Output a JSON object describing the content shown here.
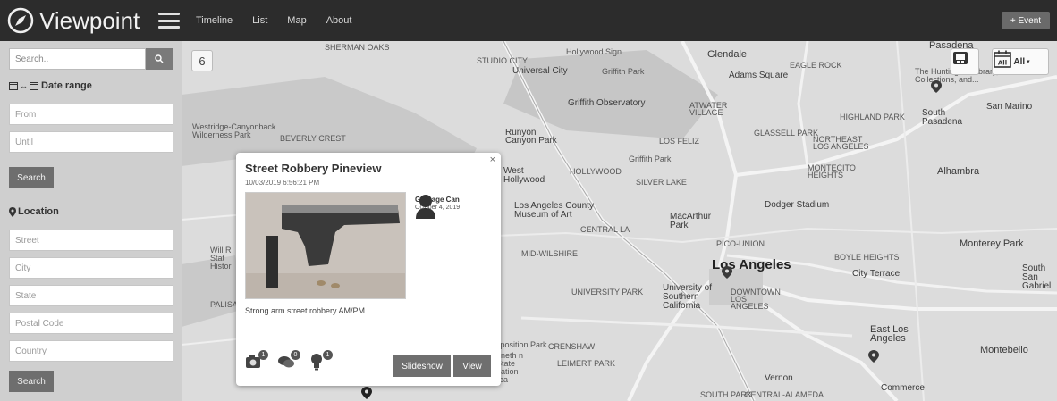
{
  "app": {
    "brand": "Viewpoint",
    "event_button": "+ Event"
  },
  "nav": [
    "Timeline",
    "List",
    "Map",
    "About"
  ],
  "sidebar": {
    "search_placeholder": "Search..",
    "date_range_label": "Date range",
    "from_placeholder": "From",
    "until_placeholder": "Until",
    "search_button": "Search",
    "location_label": "Location",
    "street_placeholder": "Street",
    "city_placeholder": "City",
    "state_placeholder": "State",
    "postal_placeholder": "Postal Code",
    "country_placeholder": "Country",
    "location_search_button": "Search"
  },
  "map": {
    "count": "6",
    "filter_label": "All",
    "calendar_icon_text": "All",
    "labels": {
      "universal_city": "Universal City",
      "studio_city": "STUDIO CITY",
      "glendale": "Glendale",
      "pasadena": "Pasadena",
      "adams_square": "Adams Square",
      "griffith_park": "Griffith Park",
      "griffith_obs": "Griffith Observatory",
      "huntington": "The Huntington Library, Art Collections, and...",
      "san_marino": "San Marino",
      "south_pasadena": "South Pasadena",
      "westridge": "Westridge-Canyonback Wilderness Park",
      "runyon": "Runyon Canyon Park",
      "los_feliz": "LOS FELIZ",
      "west_hollywood": "West Hollywood",
      "hollywood": "HOLLYWOOD",
      "silver_lake": "SILVER LAKE",
      "alhambra": "Alhambra",
      "lacma": "Los Angeles County Museum of Art",
      "macarthur": "MacArthur Park",
      "dodger": "Dodger Stadium",
      "monterey_park": "Monterey Park",
      "los_angeles": "Los Angeles",
      "city_terrace": "City Terrace",
      "south_san_gabriel": "South San Gabriel",
      "usc": "University of Southern California",
      "downtown": "DOWNTOWN LOS ANGELES",
      "east_la": "East Los Angeles",
      "montebello": "Montebello",
      "vernon": "Vernon",
      "commerce": "Commerce",
      "hollywood_sign": "Hollywood Sign",
      "highland_park": "HIGHLAND PARK",
      "glassell_park": "GLASSELL PARK",
      "eagle_rock": "EAGLE ROCK",
      "atwater": "ATWATER VILLAGE",
      "northeast": "NORTHEAST LOS ANGELES",
      "montecito": "MONTECITO HEIGHTS",
      "central_la": "CENTRAL LA",
      "mid_wilshire": "MID-WILSHIRE",
      "pico_union": "PICO-UNION",
      "university_park": "UNIVERSITY PARK",
      "boyle": "BOYLE HEIGHTS",
      "crenshaw": "CRENSHAW",
      "leimert": "LEIMERT PARK",
      "exposition": "xposition Park",
      "state_rec": "nneth n State eation rea",
      "south_park": "SOUTH PARK",
      "central_alameda": "CENTRAL-ALAMEDA",
      "beverly_crest": "BEVERLY CREST",
      "sherman_oaks": "SHERMAN OAKS",
      "will_rogers": "Will R Stat Histor",
      "palisades": "PALISA",
      "gaffey": "Griffith Park"
    }
  },
  "popup": {
    "title": "Street Robbery Pineview",
    "datetime": "10/03/2019 6:56:21 PM",
    "person_name": "Garbage Can",
    "person_date": "October 4, 2019",
    "description": "Strong arm street robbery AM/PM",
    "badge_photos": "1",
    "badge_comments": "0",
    "badge_tips": "1",
    "slideshow_button": "Slideshow",
    "view_button": "View",
    "close_glyph": "×"
  }
}
